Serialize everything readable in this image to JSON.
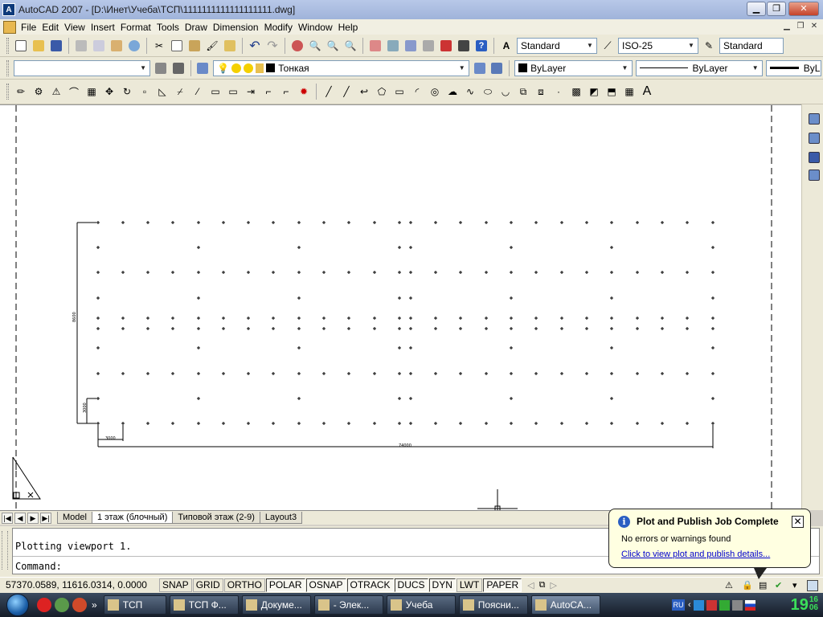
{
  "window": {
    "title": "AutoCAD 2007 - [D:\\Инет\\Учеба\\ТСП\\1111111111111111111.dwg]",
    "app_icon_label": "A",
    "controls": [
      "minimize-icon",
      "restore-icon",
      "close-icon"
    ]
  },
  "menu": {
    "items": [
      "File",
      "Edit",
      "View",
      "Insert",
      "Format",
      "Tools",
      "Draw",
      "Dimension",
      "Modify",
      "Window",
      "Help"
    ]
  },
  "toolbars": {
    "standard": {
      "text_style": "Standard",
      "dim_style": "ISO-25",
      "table_style": "Standard"
    },
    "layers": {
      "workspace_value": "",
      "current_layer": "Тонкая"
    },
    "properties": {
      "color": "ByLayer",
      "linetype": "ByLayer",
      "lineweight": "ByL"
    }
  },
  "drawing": {
    "background": "#ffffff",
    "dim_labels": [
      "8600",
      "3000",
      "3000",
      "74000"
    ],
    "grid": {
      "columns_main": [
        122,
        153,
        184,
        215,
        247,
        278,
        309,
        340,
        372,
        403,
        434,
        466,
        497,
        511,
        542,
        573,
        605,
        636,
        667,
        699,
        730,
        761,
        793,
        824,
        855,
        887
      ],
      "columns_sparse": [
        122,
        247,
        372,
        497,
        511,
        636,
        761,
        887
      ]
    }
  },
  "layout_tabs": {
    "items": [
      "Model",
      "1 этаж (блочный)",
      "Типовой этаж (2-9)",
      "Layout3"
    ],
    "active_index": 1
  },
  "command": {
    "history": "Plotting viewport 1.",
    "prompt": "Command:"
  },
  "status": {
    "coordinates": "57370.0589, 11616.0314, 0.0000",
    "toggles": [
      {
        "label": "SNAP",
        "on": false
      },
      {
        "label": "GRID",
        "on": false
      },
      {
        "label": "ORTHO",
        "on": false
      },
      {
        "label": "POLAR",
        "on": true
      },
      {
        "label": "OSNAP",
        "on": true
      },
      {
        "label": "OTRACK",
        "on": true
      },
      {
        "label": "DUCS",
        "on": true
      },
      {
        "label": "DYN",
        "on": true
      },
      {
        "label": "LWT",
        "on": false
      },
      {
        "label": "PAPER",
        "on": true
      }
    ]
  },
  "notification": {
    "title": "Plot and Publish Job Complete",
    "message": "No errors or warnings found",
    "link": "Click to view plot and publish details..."
  },
  "taskbar": {
    "tasks": [
      {
        "label": "ТСП",
        "width": 78
      },
      {
        "label": "ТСП Ф...",
        "width": 86
      },
      {
        "label": "Докуме...",
        "width": 86
      },
      {
        "label": "- Элек...",
        "width": 86
      },
      {
        "label": "Учеба",
        "width": 86
      },
      {
        "label": "Поясни...",
        "width": 86
      },
      {
        "label": "AutoCA...",
        "width": 86
      }
    ],
    "active_task_index": 6,
    "language": "RU",
    "clock": {
      "hours": "19",
      "minutes": "16",
      "seconds": "06"
    }
  }
}
